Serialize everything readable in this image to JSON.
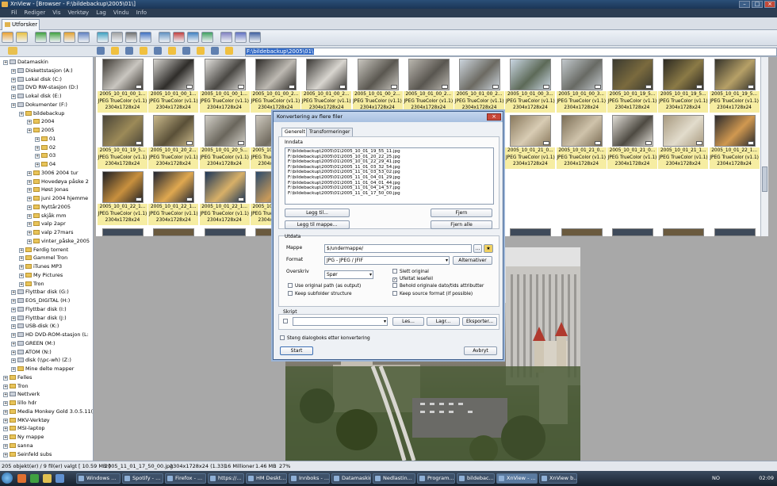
{
  "window": {
    "title": "XnView - [Browser - F:\\bildebackup\\2005\\01\\]"
  },
  "menu": [
    "Fil",
    "Rediger",
    "Vis",
    "Verktøy",
    "Lag",
    "Vindu",
    "Info"
  ],
  "tab": {
    "label": "Utforsker"
  },
  "path": {
    "value": "F:\\bildebackup\\2005\\01\\"
  },
  "tree": [
    {
      "label": "Datamaskin",
      "kind": "drive",
      "indent": 0
    },
    {
      "label": "Diskettstasjon (A:)",
      "kind": "drive",
      "indent": 1
    },
    {
      "label": "Lokal disk (C:)",
      "kind": "drive",
      "indent": 1
    },
    {
      "label": "DVD RW-stasjon (D:)",
      "kind": "drive",
      "indent": 1
    },
    {
      "label": "Lokal disk (E:)",
      "kind": "drive",
      "indent": 1
    },
    {
      "label": "Dokumenter (F:)",
      "kind": "drive",
      "indent": 1
    },
    {
      "label": "bildebackup",
      "kind": "folder",
      "indent": 2
    },
    {
      "label": "2004",
      "kind": "folder",
      "indent": 3
    },
    {
      "label": "2005",
      "kind": "folder",
      "indent": 3
    },
    {
      "label": "01",
      "kind": "folder",
      "indent": 4
    },
    {
      "label": "02",
      "kind": "folder",
      "indent": 4
    },
    {
      "label": "03",
      "kind": "folder",
      "indent": 4
    },
    {
      "label": "04",
      "kind": "folder",
      "indent": 4
    },
    {
      "label": "3006 2004 tur",
      "kind": "folder",
      "indent": 3
    },
    {
      "label": "Hovedøya påske 2",
      "kind": "folder",
      "indent": 3
    },
    {
      "label": "Høst Jonas",
      "kind": "folder",
      "indent": 3
    },
    {
      "label": "juni 2004 hjemme",
      "kind": "folder",
      "indent": 3
    },
    {
      "label": "Nyttår2005",
      "kind": "folder",
      "indent": 3
    },
    {
      "label": "skjåk mm",
      "kind": "folder",
      "indent": 3
    },
    {
      "label": "valp 2apr",
      "kind": "folder",
      "indent": 3
    },
    {
      "label": "valp 27mars",
      "kind": "folder",
      "indent": 3
    },
    {
      "label": "vinter_påske_2005",
      "kind": "folder",
      "indent": 3
    },
    {
      "label": "Ferdig torrent",
      "kind": "folder",
      "indent": 2
    },
    {
      "label": "Gammel Tron",
      "kind": "folder",
      "indent": 2
    },
    {
      "label": "iTunes MP3",
      "kind": "folder",
      "indent": 2
    },
    {
      "label": "My Pictures",
      "kind": "folder",
      "indent": 2
    },
    {
      "label": "Tron",
      "kind": "folder",
      "indent": 2
    },
    {
      "label": "Flyttbar disk (G:)",
      "kind": "drive",
      "indent": 1
    },
    {
      "label": "EOS_DIGITAL (H:)",
      "kind": "drive",
      "indent": 1
    },
    {
      "label": "Flyttbar disk (I:)",
      "kind": "drive",
      "indent": 1
    },
    {
      "label": "Flyttbar disk (J:)",
      "kind": "drive",
      "indent": 1
    },
    {
      "label": "USB-disk (K:)",
      "kind": "drive",
      "indent": 1
    },
    {
      "label": "HD DVD-ROM-stasjon (L:",
      "kind": "drive",
      "indent": 1
    },
    {
      "label": "GREEN (M:)",
      "kind": "drive",
      "indent": 1
    },
    {
      "label": "ATOM (N:)",
      "kind": "drive",
      "indent": 1
    },
    {
      "label": "disk (\\\\pc-wh) (Z:)",
      "kind": "drive",
      "indent": 1
    },
    {
      "label": "Mine delte mapper",
      "kind": "folder",
      "indent": 1
    },
    {
      "label": "Felles",
      "kind": "folder",
      "indent": 0
    },
    {
      "label": "Tron",
      "kind": "folder",
      "indent": 0
    },
    {
      "label": "Nettverk",
      "kind": "drive",
      "indent": 0
    },
    {
      "label": "lillo hdr",
      "kind": "folder",
      "indent": 0
    },
    {
      "label": "Media Monkey Gold 3.0.5.11(",
      "kind": "folder",
      "indent": 0
    },
    {
      "label": "MKV-Verktøy",
      "kind": "folder",
      "indent": 0
    },
    {
      "label": "MSI-laptop",
      "kind": "folder",
      "indent": 0
    },
    {
      "label": "Ny mappe",
      "kind": "folder",
      "indent": 0
    },
    {
      "label": "sanna",
      "kind": "folder",
      "indent": 0
    },
    {
      "label": "Seinfeld subs",
      "kind": "folder",
      "indent": 0
    }
  ],
  "thumbnails": [
    {
      "name": "2005_10_01_00_1...",
      "format": "JPEG TrueColor (v1.1)",
      "size": "2304x1728x24",
      "colors": [
        "#3e3a34",
        "#c9c6c0"
      ]
    },
    {
      "name": "2005_10_01_00_1...",
      "format": "JPEG TrueColor (v1.1)",
      "size": "2304x1728x24",
      "colors": [
        "#d5d3ce",
        "#2f2d2a"
      ]
    },
    {
      "name": "2005_10_01_00_1...",
      "format": "JPEG TrueColor (v1.1)",
      "size": "2304x1728x24",
      "colors": [
        "#e2e0dc",
        "#4a4844"
      ]
    },
    {
      "name": "2005_10_01_00_2...",
      "format": "JPEG TrueColor (v1.1)",
      "size": "2304x1728x24",
      "colors": [
        "#2d2b28",
        "#bdb9b2"
      ]
    },
    {
      "name": "2005_10_01_00_2...",
      "format": "JPEG TrueColor (v1.1)",
      "size": "2304x1728x24",
      "colors": [
        "#3a3835",
        "#d8d5cf"
      ]
    },
    {
      "name": "2005_10_01_00_2...",
      "format": "JPEG TrueColor (v1.1)",
      "size": "2304x1728x24",
      "colors": [
        "#c8c5be",
        "#5a5750"
      ]
    },
    {
      "name": "2005_10_01_00_2...",
      "format": "JPEG TrueColor (v1.1)",
      "size": "2304x1728x24",
      "colors": [
        "#b9b6ae",
        "#595650"
      ]
    },
    {
      "name": "2005_10_01_00_2...",
      "format": "JPEG TrueColor (v1.1)",
      "size": "2304x1728x24",
      "colors": [
        "#cbd4dc",
        "#6c6a62"
      ]
    },
    {
      "name": "2005_10_01_00_3...",
      "format": "JPEG TrueColor (v1.1)",
      "size": "2304x1728x24",
      "colors": [
        "#c9d6e2",
        "#5d6a58"
      ]
    },
    {
      "name": "2005_10_01_00_3...",
      "format": "JPEG TrueColor (v1.1)",
      "size": "2304x1728x24",
      "colors": [
        "#c2c8cc",
        "#686a64"
      ]
    },
    {
      "name": "2005_10_01_19_5...",
      "format": "JPEG TrueColor (v1.1)",
      "size": "2304x1728x24",
      "colors": [
        "#3b3a30",
        "#7a6a3e"
      ]
    },
    {
      "name": "2005_10_01_19_5...",
      "format": "JPEG TrueColor (v1.1)",
      "size": "2304x1728x24",
      "colors": [
        "#2c2a22",
        "#8b7a46"
      ]
    },
    {
      "name": "2005_10_01_19_5...",
      "format": "JPEG TrueColor (v1.1)",
      "size": "2304x1728x24",
      "colors": [
        "#35332b",
        "#b6a067"
      ]
    },
    {
      "name": "2005_10_01_19_5...",
      "format": "JPEG TrueColor (v1.1)",
      "size": "2304x1728x24",
      "colors": [
        "#4a4538",
        "#9c8a58"
      ]
    },
    {
      "name": "2005_10_01_20_2...",
      "format": "JPEG TrueColor (v1.1)",
      "size": "2304x1728x24",
      "colors": [
        "#c9b88a",
        "#5a5038"
      ]
    },
    {
      "name": "2005_10_01_20_5...",
      "format": "JPEG TrueColor (v1.1)",
      "size": "2304x1728x24",
      "colors": [
        "#d3d0c8",
        "#6a665c"
      ]
    },
    {
      "name": "2005_10_01_20_5...",
      "format": "JPEG TrueColor (v1.1)",
      "size": "2304x1728x24",
      "colors": [
        "#cfcac0",
        "#726c60"
      ]
    },
    {
      "name": "2005_10_01_21_0...",
      "format": "JPEG TrueColor (v1.1)",
      "size": "2304x1728x24",
      "colors": [
        "#332e28",
        "#a8884c"
      ]
    },
    {
      "name": "2005_10_01_21_0...",
      "format": "JPEG TrueColor (v1.1)",
      "size": "2304x1728x24",
      "colors": [
        "#2a2620",
        "#b08c4a"
      ]
    },
    {
      "name": "2005_10_01_21_0...",
      "format": "JPEG TrueColor (v1.1)",
      "size": "2304x1728x24",
      "colors": [
        "#3c3632",
        "#c0b0a0"
      ]
    },
    {
      "name": "2005_10_01_21_0...",
      "format": "JPEG TrueColor (v1.1)",
      "size": "2304x1728x24",
      "colors": [
        "#d8d4cc",
        "#7a2a22"
      ]
    },
    {
      "name": "2005_10_01_21_0...",
      "format": "JPEG TrueColor (v1.1)",
      "size": "2304x1728x24",
      "colors": [
        "#8a7a5e",
        "#d8ccb4"
      ]
    },
    {
      "name": "2005_10_01_21_0...",
      "format": "JPEG TrueColor (v1.1)",
      "size": "2304x1728x24",
      "colors": [
        "#7c6e56",
        "#cfc3ab"
      ]
    },
    {
      "name": "2005_10_01_21_0...",
      "format": "JPEG TrueColor (v1.1)",
      "size": "2304x1728x24",
      "colors": [
        "#e0ddd6",
        "#4e4a42"
      ]
    },
    {
      "name": "2005_10_01_21_1...",
      "format": "JPEG TrueColor (v1.1)",
      "size": "2304x1728x24",
      "colors": [
        "#a89a80",
        "#e2dccc"
      ]
    },
    {
      "name": "2005_10_01_22_1...",
      "format": "JPEG TrueColor (v1.1)",
      "size": "2304x1728x24",
      "colors": [
        "#2a2a2c",
        "#d09850"
      ]
    },
    {
      "name": "2005_10_01_22_1...",
      "format": "JPEG TrueColor (v1.1)",
      "size": "2304x1728x24",
      "colors": [
        "#1e1e22",
        "#c8903e"
      ]
    },
    {
      "name": "2005_10_01_22_1...",
      "format": "JPEG TrueColor (v1.1)",
      "size": "2304x1728x24",
      "colors": [
        "#202430",
        "#e0a850"
      ]
    },
    {
      "name": "2005_10_01_22_1...",
      "format": "JPEG TrueColor (v1.1)",
      "size": "2304x1728x24",
      "colors": [
        "#1c3658",
        "#d8b068"
      ]
    },
    {
      "name": "2005_10_01_22_1...",
      "format": "JPEG TrueColor (v1.1)",
      "size": "2304x1728x24",
      "colors": [
        "#2a4a6c",
        "#c89a5a"
      ]
    }
  ],
  "dialog": {
    "title": "Konvertering av flere filer",
    "tabs": [
      "Generelt",
      "Transformeringer"
    ],
    "input_label": "Inndata",
    "files": [
      "F:\\bildebackup\\2005\\01\\2005_10_01_19_55_11.jpg",
      "F:\\bildebackup\\2005\\01\\2005_10_01_20_22_25.jpg",
      "F:\\bildebackup\\2005\\01\\2005_10_01_22_29_41.jpg",
      "F:\\bildebackup\\2005\\01\\2005_11_01_03_32_54.jpg",
      "F:\\bildebackup\\2005\\01\\2005_11_01_03_53_02.jpg",
      "F:\\bildebackup\\2005\\01\\2005_11_01_04_01_29.jpg",
      "F:\\bildebackup\\2005\\01\\2005_11_01_04_01_44.jpg",
      "F:\\bildebackup\\2005\\01\\2005_11_01_04_14_57.jpg",
      "F:\\bildebackup\\2005\\01\\2005_11_01_17_50_00.jpg"
    ],
    "add_button": "Legg til...",
    "add_folder_button": "Legg til mappe...",
    "remove_button": "Fjern",
    "remove_all_button": "Fjern alle",
    "output_label": "Utdata",
    "folder_label": "Mappe",
    "folder_value": "$/undermappe/",
    "browse_button": "...",
    "format_label": "Format",
    "format_value": "JPG - JPEG / JFIF",
    "options_button": "Alternativer",
    "overwrite_label": "Overskriv",
    "overwrite_value": "Spør",
    "check_delete_original": {
      "label": "Slett original",
      "checked": false
    },
    "check_use_original_path": {
      "label": "Use original path (as output)",
      "checked": false
    },
    "check_keep_subfolder": {
      "label": "Keep subfolder structure",
      "checked": false
    },
    "check_change_readonly": {
      "label": "Ufeltat lesefeil",
      "checked": true
    },
    "check_keep_date": {
      "label": "Behold originale dato/tids attributter",
      "checked": false
    },
    "check_keep_source_format": {
      "label": "Keep source format (if possible)",
      "checked": false
    },
    "script_label": "Skript",
    "load_button": "Les...",
    "save_button": "Lagr...",
    "export_button": "Eksporter...",
    "close_after_label": "Steng dialogboks etter konvertering",
    "start_button": "Start",
    "cancel_button": "Avbryt"
  },
  "status": {
    "count": "205 objekt(er) / 9 fil(er) valgt  [ 10.59 MB ]",
    "filename": "2005_11_01_17_50_00.jpg",
    "dims": "2304x1728x24 (1.33)",
    "megapixels": "16 Millioner",
    "filesize": "1.46 MB",
    "zoom": "27%"
  },
  "taskbar": [
    {
      "label": "Windows ..."
    },
    {
      "label": "Spotify - ..."
    },
    {
      "label": "Firefox - ..."
    },
    {
      "label": "https://..."
    },
    {
      "label": "HM Deskt..."
    },
    {
      "label": "Innboks - ..."
    },
    {
      "label": "Datamaskin"
    },
    {
      "label": "Nedlastin..."
    },
    {
      "label": "Program..."
    },
    {
      "label": "bildebac..."
    },
    {
      "label": "XnView - ..."
    },
    {
      "label": "XnView b..."
    }
  ],
  "tray": {
    "lang": "NO",
    "clock": "02:09"
  }
}
